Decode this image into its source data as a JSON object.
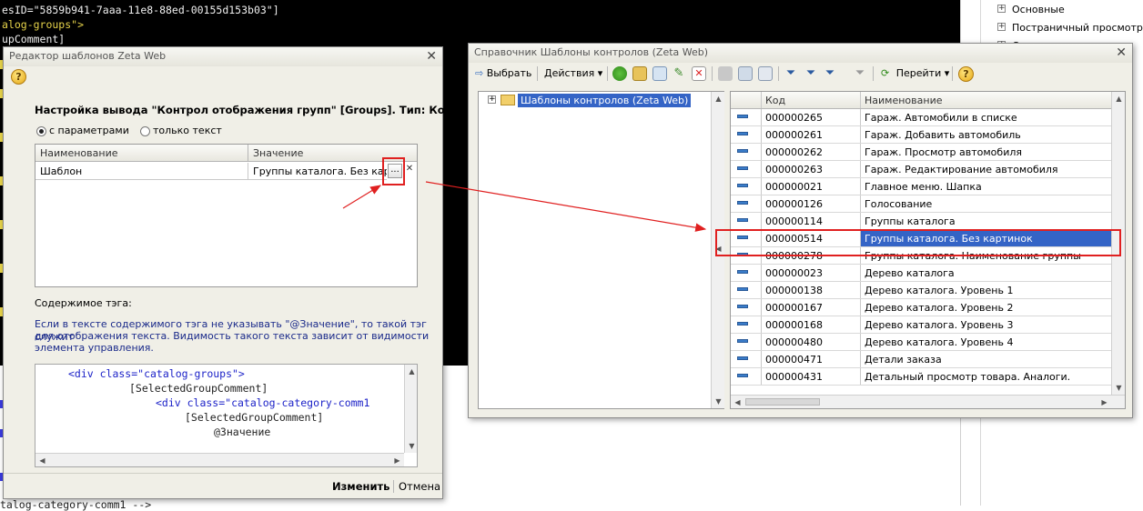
{
  "background_editor": {
    "lines": [
      {
        "text": "esID=\"5859b941-7aaa-11e8-88ed-00155d153b03\"]",
        "color": "#f0f0f0"
      },
      {
        "text": "alog-groups\">",
        "color": "#e6d34a"
      },
      {
        "text": "upComment]",
        "color": "#f0f0f0"
      }
    ],
    "bottom_line": "talog-category-comm1 -->"
  },
  "bg_tree": {
    "items": [
      "Основные",
      "Постраничный просмотр",
      "С..."
    ]
  },
  "editor_dialog": {
    "title": "Редактор шаблонов Zeta Web",
    "help": "?",
    "close": "✕",
    "heading": "Настройка вывода \"Контрол отображения групп\" [Groups]. Тип: Кон...",
    "radio_params": "с параметрами",
    "radio_text": "только текст",
    "grid": {
      "col_name": "Наименование",
      "col_value": "Значение",
      "row_name": "Шаблон",
      "row_value": "Группы каталога. Без картин",
      "btn_select": "...",
      "btn_clear": "✕"
    },
    "content_label": "Содержимое тэга:",
    "hint": [
      "Если в тексте содержимого тэга не указывать \"@Значение\", то такой тэг служит",
      "для отображения текста. Видимость такого текста зависит от видимости",
      "элемента управления."
    ],
    "code_lines": [
      "<div class=\"catalog-groups\">",
      "[SelectedGroupComment]",
      "<div class=\"catalog-category-comm1",
      "[SelectedGroupComment]",
      "@Значение"
    ],
    "btn_change": "Изменить",
    "btn_cancel": "Отмена"
  },
  "list_window": {
    "title": "Справочник Шаблоны контролов (Zeta Web)",
    "close": "✕",
    "toolbar": {
      "select": "Выбрать",
      "actions": "Действия",
      "goto": "Перейти",
      "help": "?"
    },
    "tree_root": "Шаблоны контролов (Zeta Web)",
    "columns": {
      "code": "Код",
      "name": "Наименование"
    },
    "rows": [
      {
        "code": "000000265",
        "name": "Гараж. Автомобили в списке"
      },
      {
        "code": "000000261",
        "name": "Гараж. Добавить автомобиль"
      },
      {
        "code": "000000262",
        "name": "Гараж. Просмотр автомобиля"
      },
      {
        "code": "000000263",
        "name": "Гараж. Редактирование автомобиля"
      },
      {
        "code": "000000021",
        "name": "Главное меню. Шапка"
      },
      {
        "code": "000000126",
        "name": "Голосование"
      },
      {
        "code": "000000114",
        "name": "Группы каталога"
      },
      {
        "code": "000000514",
        "name": "Группы каталога. Без картинок",
        "selected": true
      },
      {
        "code": "000000278",
        "name": "Группы каталога. Наименование группы"
      },
      {
        "code": "000000023",
        "name": "Дерево каталога"
      },
      {
        "code": "000000138",
        "name": "Дерево каталога. Уровень 1"
      },
      {
        "code": "000000167",
        "name": "Дерево каталога. Уровень 2"
      },
      {
        "code": "000000168",
        "name": "Дерево каталога. Уровень 3"
      },
      {
        "code": "000000480",
        "name": "Дерево каталога. Уровень 4"
      },
      {
        "code": "000000471",
        "name": "Детали заказа"
      },
      {
        "code": "000000431",
        "name": "Детальный просмотр товара. Аналоги."
      }
    ]
  },
  "colors": {
    "selection": "#3464c6",
    "annotation_red": "#e02020",
    "code_blue": "#1c22c8"
  }
}
